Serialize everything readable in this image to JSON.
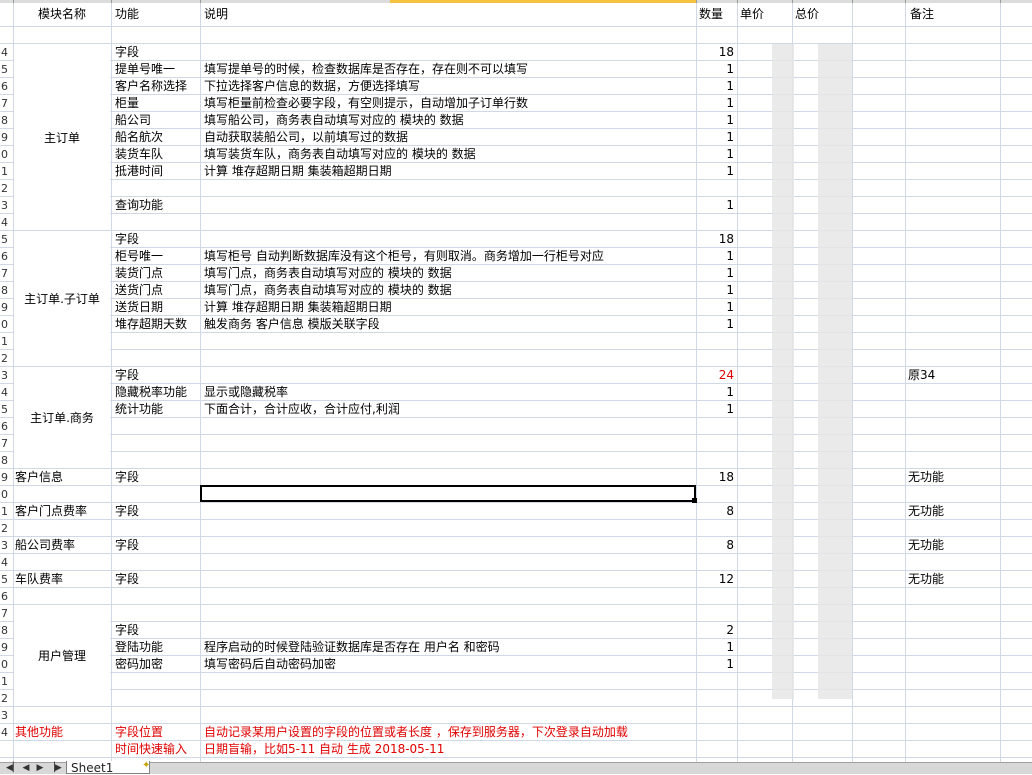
{
  "header": {
    "col_a": "模块名称",
    "col_b": "功能",
    "col_c": "说明",
    "col_d": "数量",
    "col_e": "单价",
    "col_f": "总价",
    "col_h": "备注"
  },
  "row_numbers": [
    "",
    "",
    "4",
    "5",
    "6",
    "7",
    "8",
    "9",
    "0",
    "1",
    "2",
    "3",
    "4",
    "5",
    "6",
    "7",
    "8",
    "9",
    "0",
    "1",
    "2",
    "3",
    "4",
    "5",
    "6",
    "7",
    "8",
    "9",
    "0",
    "1",
    "2",
    "3",
    "4",
    "5",
    "6",
    "7",
    "8",
    "9",
    "0",
    "1",
    "2",
    "3",
    "4"
  ],
  "rows": [
    {
      "a": "",
      "b": "",
      "c": "",
      "d": "",
      "h": ""
    },
    {
      "a": "",
      "b": "字段",
      "c": "",
      "d": "18",
      "h": ""
    },
    {
      "a": "",
      "b": "提单号唯一",
      "c": "填写提单号的时候，检查数据库是否存在，存在则不可以填写",
      "d": "1",
      "h": ""
    },
    {
      "a": "",
      "b": "客户名称选择",
      "c": "下拉选择客户信息的数据，方便选择填写",
      "d": "1",
      "h": ""
    },
    {
      "a": "",
      "b": "柜量",
      "c": "填写柜量前检查必要字段，有空则提示，自动增加子订单行数",
      "d": "1",
      "h": ""
    },
    {
      "a": "",
      "b": "船公司",
      "c": "填写船公司，商务表自动填写对应的 模块的 数据",
      "d": "1",
      "h": ""
    },
    {
      "a": "",
      "b": "船名航次",
      "c": "自动获取装船公司，以前填写过的数据",
      "d": "1",
      "h": ""
    },
    {
      "a": "",
      "b": "装货车队",
      "c": "填写装货车队，商务表自动填写对应的 模块的 数据",
      "d": "1",
      "h": ""
    },
    {
      "a": "",
      "b": "抵港时间",
      "c": "计算 堆存超期日期  集装箱超期日期",
      "d": "1",
      "h": ""
    },
    {
      "a": "",
      "b": "",
      "c": "",
      "d": "",
      "h": ""
    },
    {
      "a": "",
      "b": "查询功能",
      "c": "",
      "d": "1",
      "h": ""
    },
    {
      "a": "",
      "b": "",
      "c": "",
      "d": "",
      "h": ""
    },
    {
      "a": "",
      "b": "字段",
      "c": "",
      "d": "18",
      "h": ""
    },
    {
      "a": "",
      "b": "柜号唯一",
      "c": "填写柜号 自动判断数据库没有这个柜号，有则取消。商务增加一行柜号对应",
      "d": "1",
      "h": ""
    },
    {
      "a": "",
      "b": "装货门点",
      "c": "填写门点，商务表自动填写对应的 模块的 数据",
      "d": "1",
      "h": ""
    },
    {
      "a": "",
      "b": "送货门点",
      "c": "填写门点，商务表自动填写对应的 模块的 数据",
      "d": "1",
      "h": ""
    },
    {
      "a": "",
      "b": "送货日期",
      "c": "计算 堆存超期日期  集装箱超期日期",
      "d": "1",
      "h": ""
    },
    {
      "a": "",
      "b": "堆存超期天数",
      "c": "触发商务 客户信息 模版关联字段",
      "d": "1",
      "h": ""
    },
    {
      "a": "",
      "b": "",
      "c": "",
      "d": "",
      "h": ""
    },
    {
      "a": "",
      "b": "",
      "c": "",
      "d": "",
      "h": ""
    },
    {
      "a": "",
      "b": "字段",
      "c": "",
      "d": "24",
      "h": "原34",
      "d_red": true
    },
    {
      "a": "",
      "b": "隐藏税率功能",
      "c": "显示或隐藏税率",
      "d": "1",
      "h": ""
    },
    {
      "a": "",
      "b": "统计功能",
      "c": "下面合计，合计应收，合计应付,利润",
      "d": "1",
      "h": ""
    },
    {
      "a": "",
      "b": "",
      "c": "",
      "d": "",
      "h": ""
    },
    {
      "a": "",
      "b": "",
      "c": "",
      "d": "",
      "h": ""
    },
    {
      "a": "",
      "b": "",
      "c": "",
      "d": "",
      "h": ""
    },
    {
      "a": "客户信息",
      "b": "字段",
      "c": "",
      "d": "18",
      "h": "无功能"
    },
    {
      "a": "",
      "b": "",
      "c": "",
      "d": "",
      "h": ""
    },
    {
      "a": "客户门点费率",
      "b": "字段",
      "c": "",
      "d": "8",
      "h": "无功能"
    },
    {
      "a": "",
      "b": "",
      "c": "",
      "d": "",
      "h": ""
    },
    {
      "a": "船公司费率",
      "b": "字段",
      "c": "",
      "d": "8",
      "h": "无功能"
    },
    {
      "a": "",
      "b": "",
      "c": "",
      "d": "",
      "h": ""
    },
    {
      "a": "车队费率",
      "b": "字段",
      "c": "",
      "d": "12",
      "h": "无功能"
    },
    {
      "a": "",
      "b": "",
      "c": "",
      "d": "",
      "h": ""
    },
    {
      "a": "",
      "b": "",
      "c": "",
      "d": "",
      "h": ""
    },
    {
      "a": "",
      "b": "字段",
      "c": "",
      "d": "2",
      "h": ""
    },
    {
      "a": "",
      "b": "登陆功能",
      "c": "程序启动的时候登陆验证数据库是否存在 用户名 和密码",
      "d": "1",
      "h": ""
    },
    {
      "a": "",
      "b": "密码加密",
      "c": "填写密码后自动密码加密",
      "d": "1",
      "h": ""
    },
    {
      "a": "",
      "b": "",
      "c": "",
      "d": "",
      "h": ""
    },
    {
      "a": "",
      "b": "",
      "c": "",
      "d": "",
      "h": ""
    },
    {
      "a": "",
      "b": "",
      "c": "",
      "d": "",
      "h": ""
    },
    {
      "a": "其他功能",
      "b": "字段位置",
      "c": "自动记录某用户设置的字段的位置或者长度 ，保存到服务器，下次登录自动加载",
      "d": "",
      "h": "",
      "red": true
    },
    {
      "a": "",
      "b": "时间快速输入",
      "c": "日期盲输，比如5-11 自动 生成 2018-05-11",
      "d": "",
      "h": "",
      "red": true
    }
  ],
  "merged_modules": [
    {
      "label": "主订单",
      "start": 1,
      "end": 11
    },
    {
      "label": "主订单.子订单",
      "start": 12,
      "end": 19
    },
    {
      "label": "主订单.商务",
      "start": 20,
      "end": 25
    },
    {
      "label": "用户管理",
      "start": 34,
      "end": 39
    }
  ],
  "sheet_tab": {
    "label": "Sheet1",
    "insert_icon": "new-sheet-icon"
  },
  "nav_icons": [
    "first-sheet-icon",
    "prev-sheet-icon",
    "next-sheet-icon",
    "last-sheet-icon"
  ],
  "colors": {
    "grid": "#d0d7e5",
    "red": "#e00000",
    "accent": "#f5c242"
  }
}
